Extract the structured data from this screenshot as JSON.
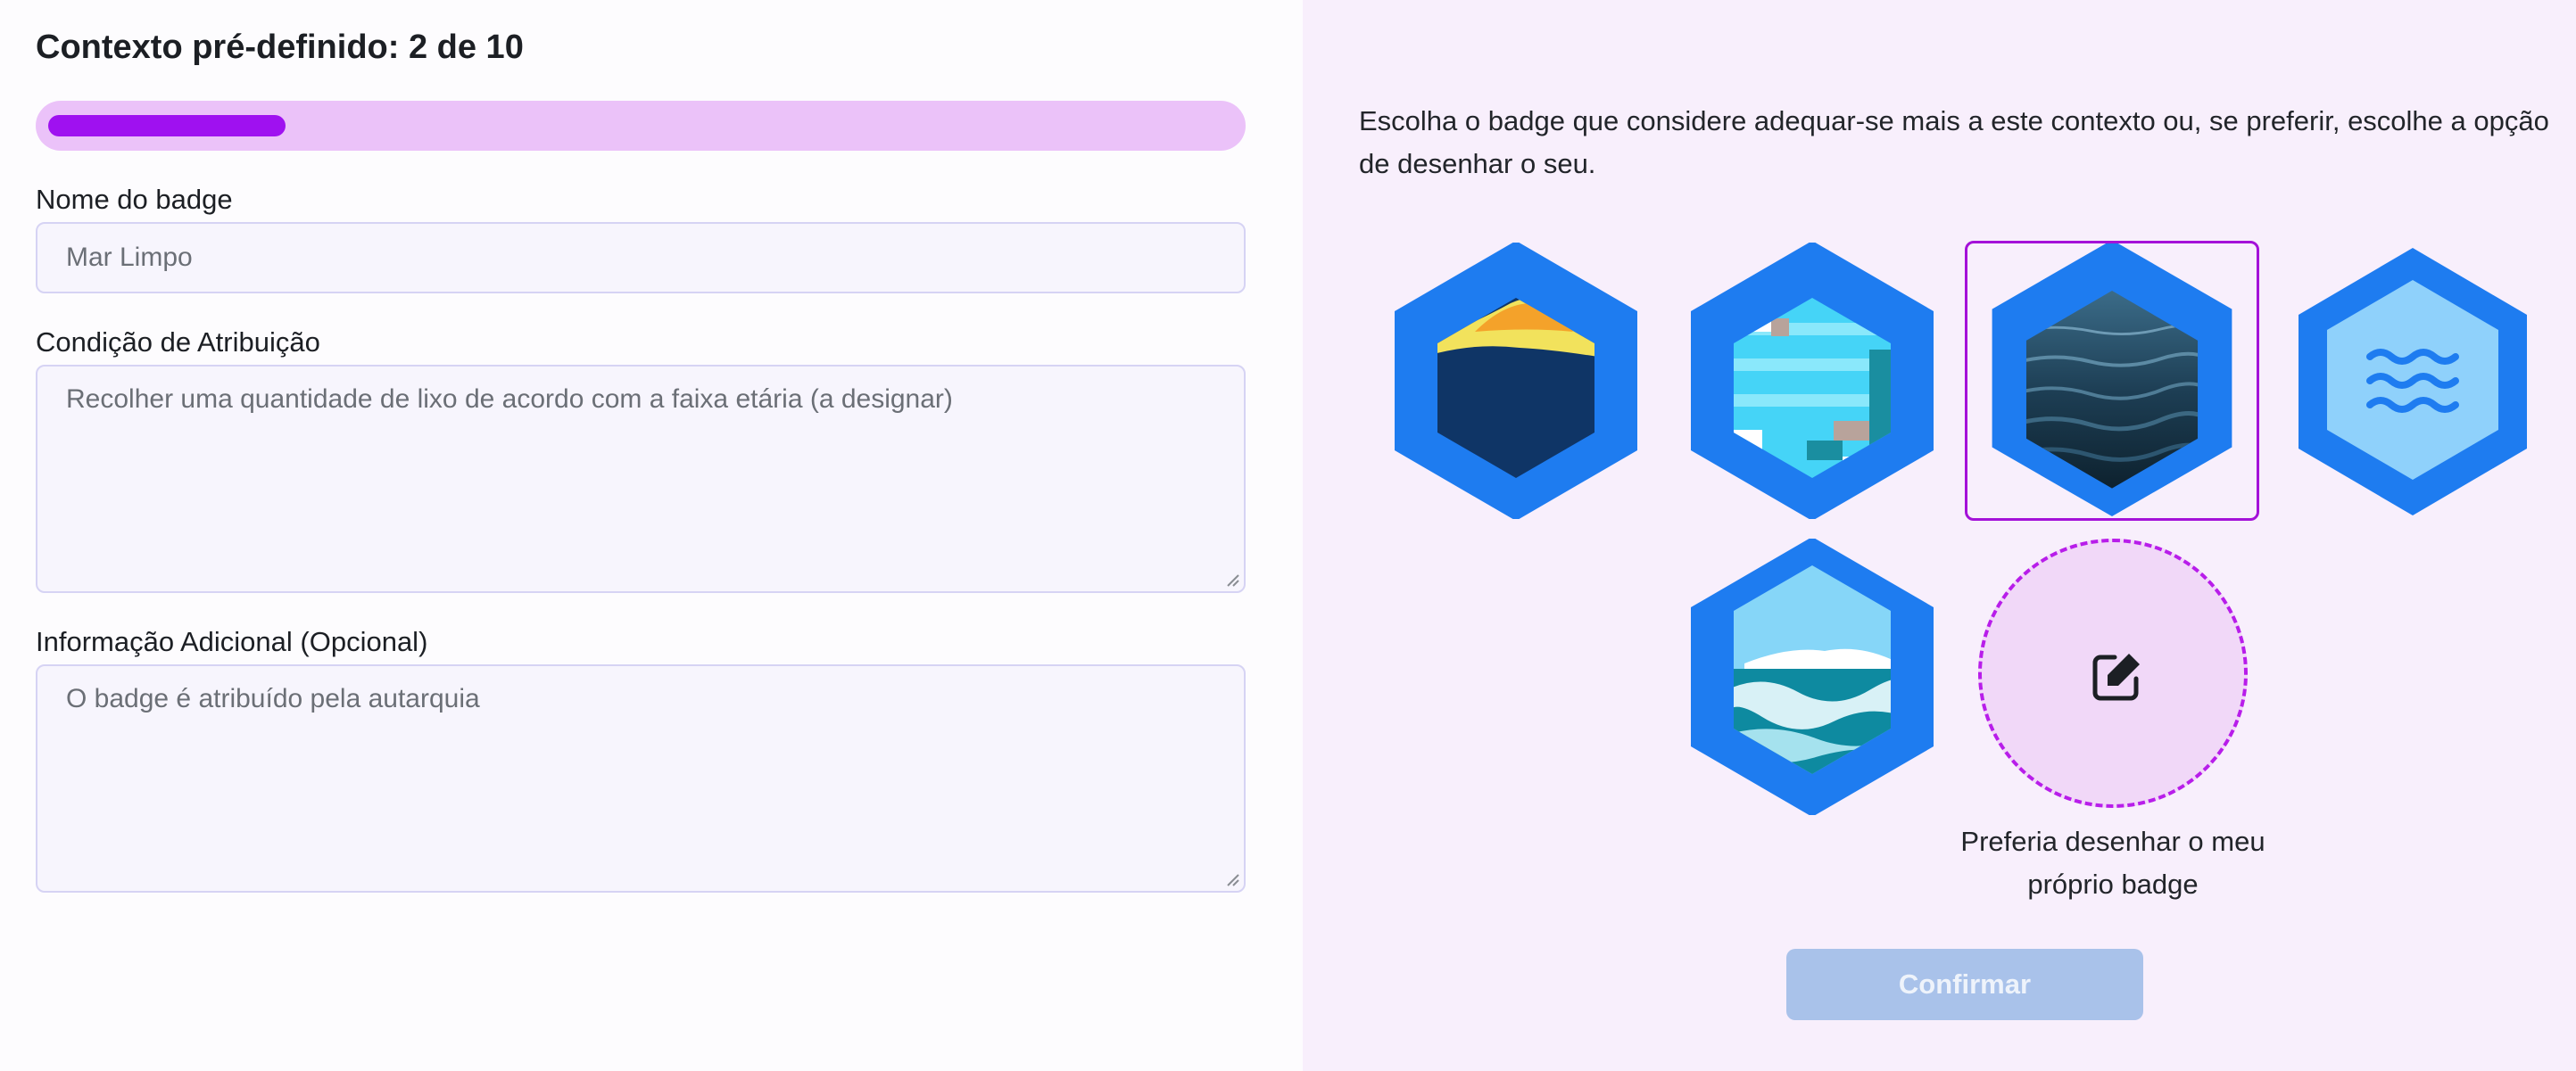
{
  "context": {
    "title": "Contexto pré-definido: 2 de 10",
    "progress_fraction": 0.2
  },
  "form": {
    "name_label": "Nome do badge",
    "name_value": "Mar Limpo",
    "condition_label": "Condição de Atribuição",
    "condition_value": "Recolher uma quantidade de lixo de acordo com a faixa etária (a designar)",
    "additional_label": "Informação Adicional (Opcional)",
    "additional_value": "O badge é atribuído pela autarquia"
  },
  "picker": {
    "description": "Escolha o badge que considere adequar-se mais a este contexto ou, se preferir, escolhe a opção de desenhar o seu.",
    "badges": [
      {
        "name": "sunset-sea-badge",
        "selected": false
      },
      {
        "name": "pixel-water-badge",
        "selected": false
      },
      {
        "name": "ocean-waves-photo-badge",
        "selected": true
      },
      {
        "name": "water-waves-icon-badge",
        "selected": false
      },
      {
        "name": "breaking-wave-badge",
        "selected": false
      }
    ],
    "draw_option_label": "Preferia desenhar o meu próprio badge",
    "draw_option_icon": "edit-icon",
    "confirm_label": "Confirmar"
  },
  "colors": {
    "accent_purple": "#a411d8",
    "badge_blue": "#1e7cf0",
    "progress_fill": "#9f11f0",
    "confirm_disabled": "#a9c2ea"
  }
}
